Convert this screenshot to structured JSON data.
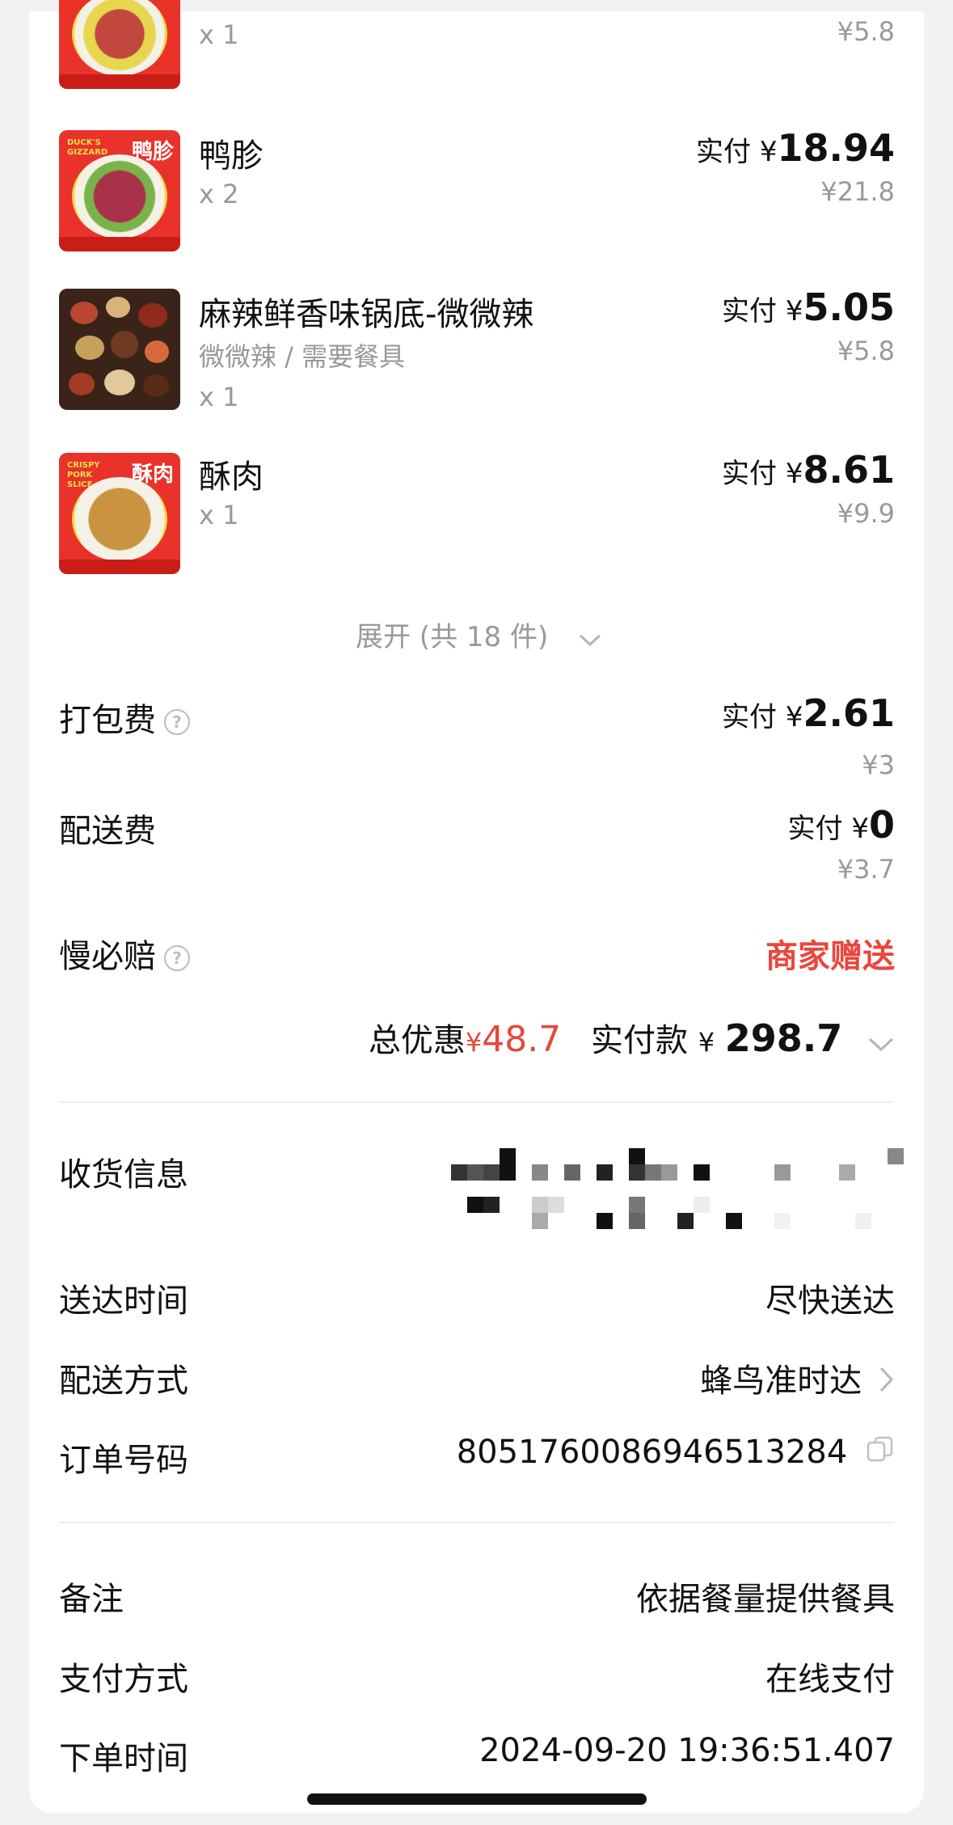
{
  "items": [
    {
      "name": "",
      "qty": "x 1",
      "paid_prefix": "",
      "paid_amount": "",
      "original": "¥5.8"
    },
    {
      "name": "鸭胗",
      "img_tag": "鸭胗",
      "img_eng": "DUCK'S GIZZARD",
      "qty": "x 2",
      "paid_prefix": "实付 ¥",
      "paid_amount": "18.94",
      "original": "¥21.8"
    },
    {
      "name": "麻辣鲜香味锅底-微微辣",
      "spec": "微微辣 / 需要餐具",
      "qty": "x 1",
      "paid_prefix": "实付 ¥",
      "paid_amount": "5.05",
      "original": "¥5.8"
    },
    {
      "name": "酥肉",
      "img_tag": "酥肉",
      "img_eng": "CRISPY PORK SLICE",
      "qty": "x 1",
      "paid_prefix": "实付 ¥",
      "paid_amount": "8.61",
      "original": "¥9.9"
    }
  ],
  "expand": {
    "label": "展开 (共 18 件)"
  },
  "fees": {
    "packing": {
      "label": "打包费",
      "paid_prefix": "实付 ¥",
      "paid_amount": "2.61",
      "original": "¥3"
    },
    "delivery": {
      "label": "配送费",
      "paid_prefix": "实付 ¥",
      "paid_amount": "0",
      "original": "¥3.7"
    },
    "late_comp": {
      "label": "慢必赔",
      "value": "商家赠送"
    }
  },
  "summary": {
    "discount_label": "总优惠",
    "discount_currency": "¥",
    "discount_value": "48.7",
    "paid_label": "实付款",
    "paid_currency": "¥",
    "paid_value": "298.7"
  },
  "info": {
    "address_label": "收货信息",
    "time_label": "送达时间",
    "time_value": "尽快送达",
    "method_label": "配送方式",
    "method_value": "蜂鸟准时达",
    "order_label": "订单号码",
    "order_value": "8051760086946513284"
  },
  "extra": {
    "note_label": "备注",
    "note_value": "依据餐量提供餐具",
    "pay_label": "支付方式",
    "pay_value": "在线支付",
    "time_label": "下单时间",
    "time_value": "2024-09-20 19:36:51.407"
  },
  "icons": {
    "help": "question-circle-icon",
    "chevron_down": "chevron-down-icon",
    "chevron_right": "chevron-right-icon",
    "copy": "copy-icon"
  },
  "colors": {
    "accent_red": "#e8473c",
    "text": "#111111",
    "muted": "#999999"
  }
}
